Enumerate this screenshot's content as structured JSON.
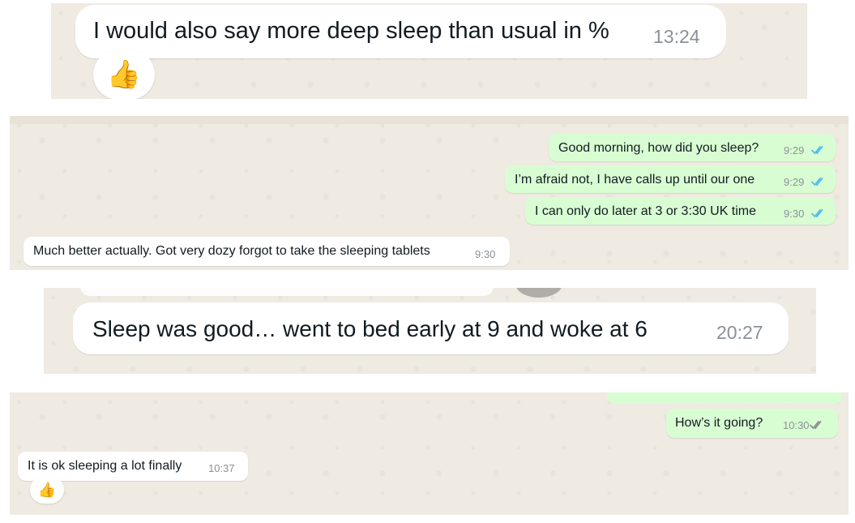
{
  "colors": {
    "chat_background": "#efeae2",
    "incoming_bubble": "#ffffff",
    "outgoing_bubble": "#d9fdd3",
    "timestamp": "#8a9197",
    "read_ticks_blue": "#53bdeb",
    "delivered_ticks_grey": "#8a9197"
  },
  "panel1": {
    "message": {
      "text": "I would also say more deep sleep than usual in %",
      "time": "13:24",
      "direction": "incoming"
    },
    "reaction": "👍"
  },
  "panel2": {
    "messages": [
      {
        "text": "Good morning, how did you sleep?",
        "time": "9:29",
        "direction": "outgoing",
        "status": "read"
      },
      {
        "text": "I’m afraid not, I have calls up until our one",
        "time": "9:29",
        "direction": "outgoing",
        "status": "read"
      },
      {
        "text": "I can only do later at 3 or 3:30 UK time",
        "time": "9:30",
        "direction": "outgoing",
        "status": "read"
      },
      {
        "text": "Much better actually. Got very dozy forgot to take the sleeping tablets",
        "time": "9:30",
        "direction": "incoming"
      }
    ]
  },
  "panel3": {
    "message": {
      "text": "Sleep was good… went to bed early at 9 and woke at 6",
      "time": "20:27",
      "direction": "incoming"
    }
  },
  "panel4": {
    "messages": [
      {
        "text": "How’s it going?",
        "time": "10:30",
        "direction": "outgoing",
        "status": "delivered"
      },
      {
        "text": "It is ok sleeping a lot finally",
        "time": "10:37",
        "direction": "incoming"
      }
    ],
    "reaction": "👍"
  }
}
